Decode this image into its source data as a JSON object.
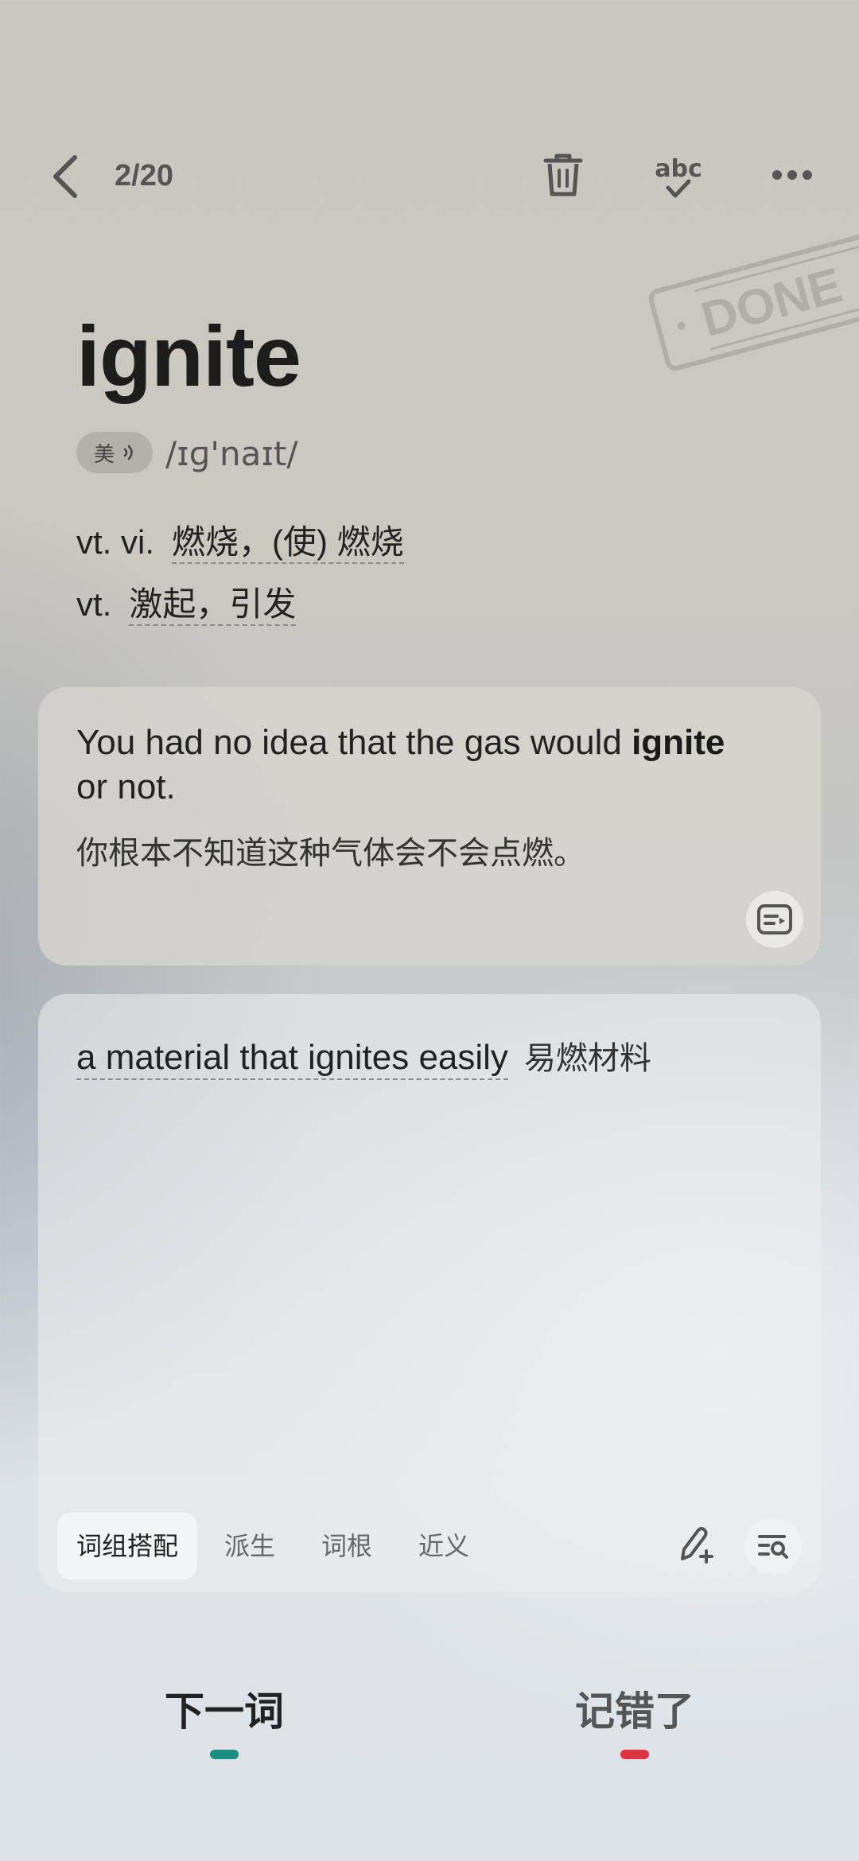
{
  "header": {
    "counter": "2/20",
    "icons": [
      "back-icon",
      "trash-icon",
      "spell-check-icon",
      "more-icon"
    ]
  },
  "stamp": {
    "text": "DONE"
  },
  "word": {
    "headword": "ignite",
    "region": "美",
    "phonetic": "/ɪɡ'naɪt/",
    "definitions": [
      {
        "pos": "vt. vi.",
        "meaning": "燃烧，(使) 燃烧"
      },
      {
        "pos": "vt.",
        "meaning": "激起，引发"
      }
    ]
  },
  "example": {
    "en_before": "You had no idea that the gas would ",
    "en_bold": "ignite",
    "en_after": " or not.",
    "cn": "你根本不知道这种气体会不会点燃。"
  },
  "collocation": {
    "en": "a material that ignites easily",
    "cn": "易燃材料"
  },
  "tabs": [
    "词组搭配",
    "派生",
    "词根",
    "近义"
  ],
  "bottom": {
    "next_label": "下一词",
    "wrong_label": "记错了"
  },
  "colors": {
    "next_indicator": "#1a8f80",
    "wrong_indicator": "#de3343"
  }
}
